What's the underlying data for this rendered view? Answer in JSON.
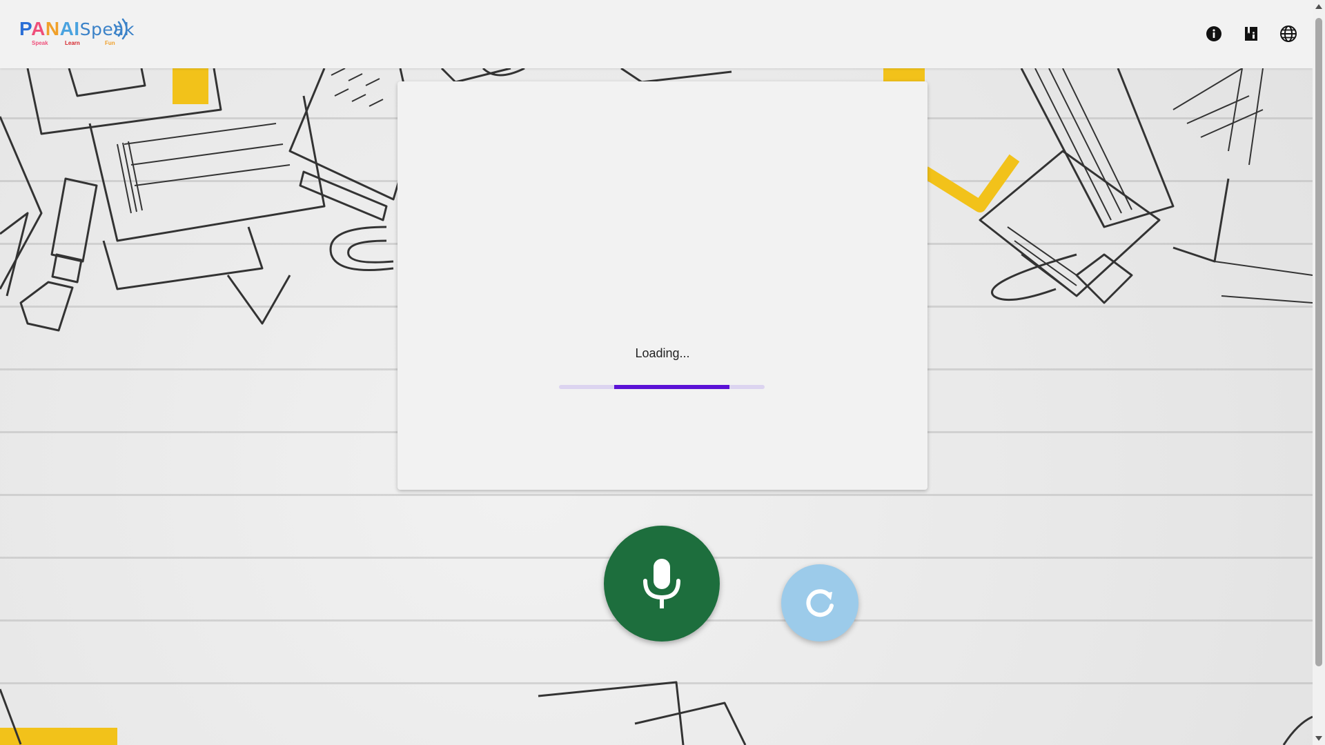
{
  "header": {
    "logo": {
      "letters": [
        "P",
        "A",
        "N",
        "AI"
      ],
      "word": "Speak",
      "tagline": [
        "Speak",
        "Learn",
        "Fun"
      ]
    },
    "icons": [
      {
        "name": "info-icon",
        "label": "info"
      },
      {
        "name": "book-icon",
        "label": "book"
      },
      {
        "name": "language-icon",
        "label": "language"
      }
    ]
  },
  "card": {
    "loading_text": "Loading...",
    "progress": {
      "start": 0.27,
      "end": 0.83
    }
  },
  "controls": {
    "mic_icon": "microphone-icon",
    "refresh_icon": "refresh-icon"
  },
  "colors": {
    "mic_button": "#1d6e3d",
    "refresh_button": "#9ccbea",
    "progress_fill": "#5b12d6",
    "progress_track": "#dcd4f0"
  }
}
